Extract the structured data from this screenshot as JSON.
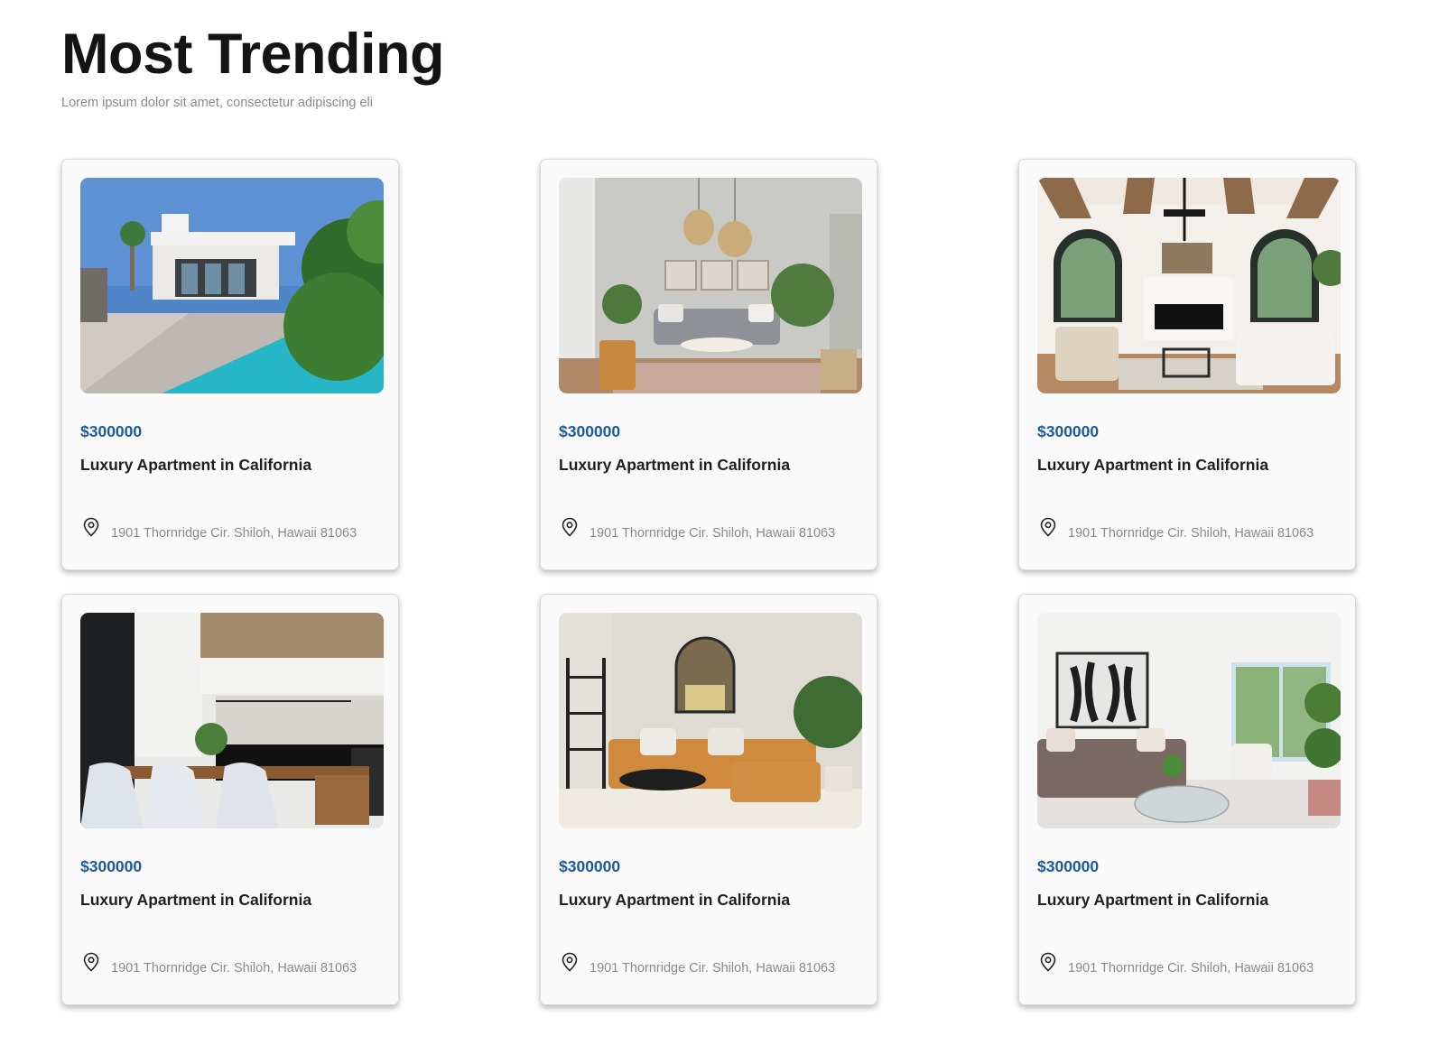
{
  "section": {
    "title": "Most Trending",
    "subtitle": "Lorem ipsum dolor sit amet, consectetur adipiscing eli"
  },
  "colors": {
    "price": "#1c5a9a",
    "title": "#141414",
    "muted": "#8a8a8a"
  },
  "listings": [
    {
      "price": "$300000",
      "title": "Luxury Apartment in California",
      "address": "1901 Thornridge Cir. Shiloh, Hawaii 81063",
      "image": "modern-house-with-pool-photo",
      "icon": "map-pin-icon"
    },
    {
      "price": "$300000",
      "title": "Luxury Apartment in California",
      "address": "1901 Thornridge Cir. Shiloh, Hawaii 81063",
      "image": "living-room-pendant-lamps-photo",
      "icon": "map-pin-icon"
    },
    {
      "price": "$300000",
      "title": "Luxury Apartment in California",
      "address": "1901 Thornridge Cir. Shiloh, Hawaii 81063",
      "image": "living-room-fireplace-arched-windows-photo",
      "icon": "map-pin-icon"
    },
    {
      "price": "$300000",
      "title": "Luxury Apartment in California",
      "address": "1901 Thornridge Cir. Shiloh, Hawaii 81063",
      "image": "kitchen-dining-table-photo",
      "icon": "map-pin-icon"
    },
    {
      "price": "$300000",
      "title": "Luxury Apartment in California",
      "address": "1901 Thornridge Cir. Shiloh, Hawaii 81063",
      "image": "orange-sofa-living-room-photo",
      "icon": "map-pin-icon"
    },
    {
      "price": "$300000",
      "title": "Luxury Apartment in California",
      "address": "1901 Thornridge Cir. Shiloh, Hawaii 81063",
      "image": "bright-living-room-artwork-photo",
      "icon": "map-pin-icon"
    }
  ]
}
